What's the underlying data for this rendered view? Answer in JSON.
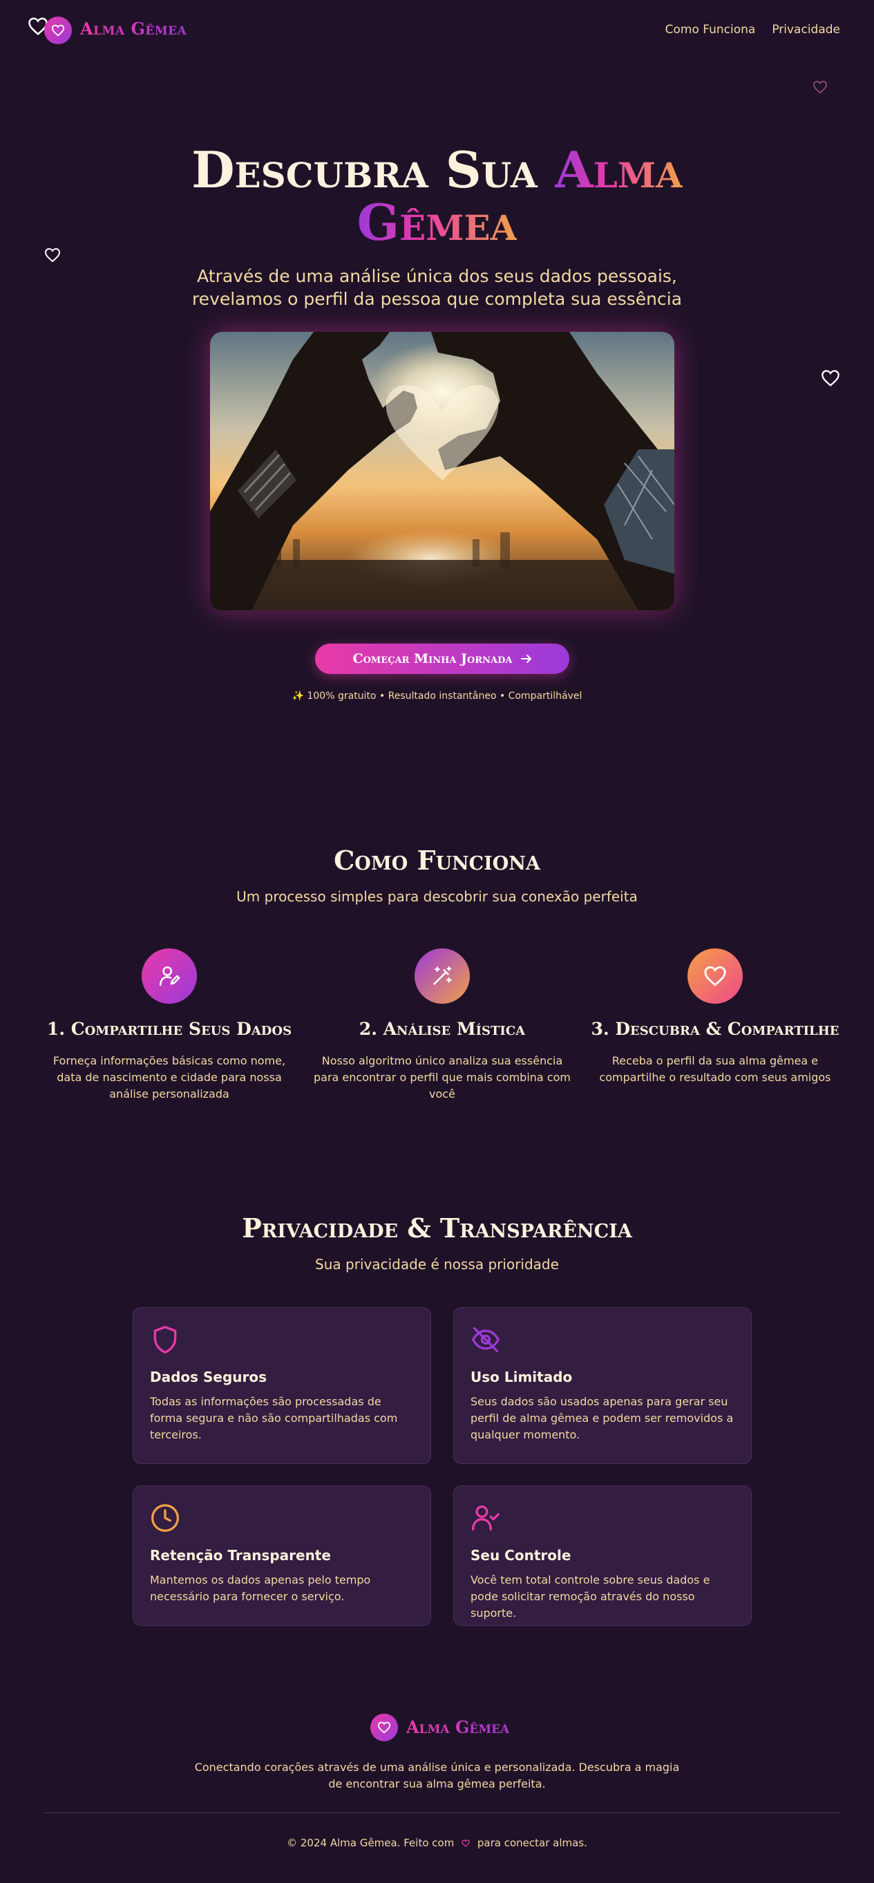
{
  "nav": {
    "brand": "Alma Gêmea",
    "links": [
      "Como Funciona",
      "Privacidade"
    ]
  },
  "hero": {
    "title_main": "Descubra Sua",
    "title_accent_1": "Alma",
    "title_accent_2": "Gêmea",
    "subtitle_line1": "Através de uma análise única dos seus dados pessoais,",
    "subtitle_line2": "revelamos o perfil da pessoa que completa sua essência",
    "cta_label": "Começar Minha Jornada",
    "cta_note": "✨ 100% gratuito • Resultado instantâneo • Compartilhável"
  },
  "how": {
    "title": "Como Funciona",
    "subtitle": "Um processo simples para descobrir sua conexão perfeita",
    "steps": [
      {
        "icon": "user-edit-icon",
        "title": "1. Compartilhe Seus Dados",
        "desc": "Forneça informações básicas como nome, data de nascimento e cidade para nossa análise personalizada"
      },
      {
        "icon": "magic-wand-icon",
        "title": "2. Análise Mística",
        "desc": "Nosso algoritmo único analiza sua essência para encontrar o perfil que mais combina com você"
      },
      {
        "icon": "heart-icon",
        "title": "3. Descubra & Compartilhe",
        "desc": "Receba o perfil da sua alma gêmea e compartilhe o resultado com seus amigos"
      }
    ]
  },
  "privacy": {
    "title": "Privacidade & Transparência",
    "subtitle": "Sua privacidade é nossa prioridade",
    "cards": [
      {
        "icon": "shield-icon",
        "title": "Dados Seguros",
        "desc": "Todas as informações são processadas de forma segura e não são compartilhadas com terceiros."
      },
      {
        "icon": "eye-off-icon",
        "title": "Uso Limitado",
        "desc": "Seus dados são usados apenas para gerar seu perfil de alma gêmea e podem ser removidos a qualquer momento."
      },
      {
        "icon": "clock-icon",
        "title": "Retenção Transparente",
        "desc": "Mantemos os dados apenas pelo tempo necessário para fornecer o serviço."
      },
      {
        "icon": "user-check-icon",
        "title": "Seu Controle",
        "desc": "Você tem total controle sobre seus dados e pode solicitar remoção através do nosso suporte."
      }
    ]
  },
  "footer": {
    "brand": "Alma Gêmea",
    "desc": "Conectando corações através de uma análise única e personalizada. Descubra a magia de encontrar sua alma gêmea perfeita.",
    "copy_before": "© 2024 Alma Gêmea. Feito com",
    "copy_after": "para conectar almas."
  },
  "colors": {
    "background": "#1f1228",
    "pink": "#e83aa8",
    "purple": "#9b3ad8",
    "orange": "#f0a04a",
    "cream": "#f3d9a4"
  }
}
